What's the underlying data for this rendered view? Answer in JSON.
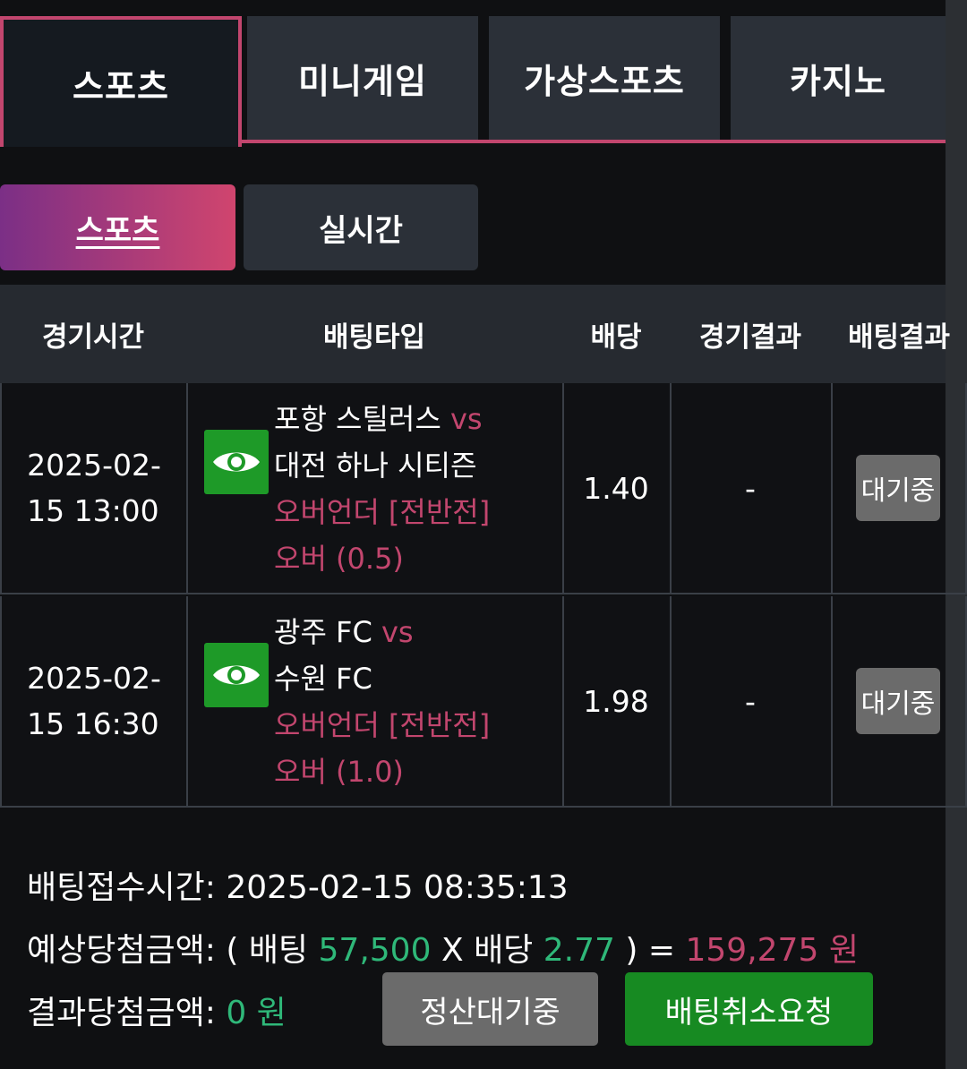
{
  "category_tabs": [
    "스포츠",
    "미니게임",
    "가상스포츠",
    "카지노"
  ],
  "sub_tabs": [
    "스포츠",
    "실시간"
  ],
  "table": {
    "headers": [
      "경기시간",
      "배팅타입",
      "배당",
      "경기결과",
      "배팅결과"
    ],
    "rows": [
      {
        "time_line1": "2025-02-",
        "time_line2": "15 13:00",
        "home": "포항 스틸러스",
        "vs": "vs",
        "away": "대전 하나 시티즌",
        "market": "오버언더 [전반전]",
        "pick": "오버 (0.5)",
        "odds": "1.40",
        "match_result": "-",
        "bet_result": "대기중"
      },
      {
        "time_line1": "2025-02-",
        "time_line2": "15 16:30",
        "home": "광주 FC",
        "vs": "vs",
        "away": "수원 FC",
        "market": "오버언더 [전반전]",
        "pick": "오버 (1.0)",
        "odds": "1.98",
        "match_result": "-",
        "bet_result": "대기중"
      }
    ]
  },
  "summary": {
    "accept_time_label": "배팅접수시간:",
    "accept_time": "2025-02-15 08:35:13",
    "expected_label": "예상당첨금액:",
    "open_paren": "(",
    "bet_label": "배팅",
    "bet_amount": "57,500",
    "times": "X",
    "odds_label": "배당",
    "total_odds": "2.77",
    "close_paren": ")",
    "equals": "=",
    "expected_amount": "159,275 원",
    "result_label": "결과당첨금액:",
    "result_amount": "0 원"
  },
  "buttons": {
    "settle_pending": "정산대기중",
    "cancel_request": "배팅취소요청"
  },
  "colors": {
    "accent_pink": "#c2466e",
    "positive_green": "#2fb879",
    "button_green": "#178a22"
  }
}
